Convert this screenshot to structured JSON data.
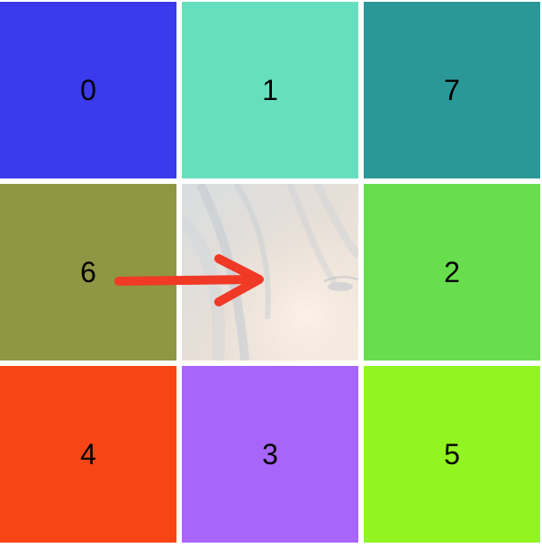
{
  "tiles": [
    {
      "label": "0",
      "color": "#3b3aed"
    },
    {
      "label": "1",
      "color": "#66dfbf"
    },
    {
      "label": "7",
      "color": "#2a9896"
    },
    {
      "label": "6",
      "color": "#909644"
    },
    {
      "label": "2",
      "color": "#68dd4d"
    },
    {
      "label": "4",
      "color": "#f84515"
    },
    {
      "label": "3",
      "color": "#a865f9"
    },
    {
      "label": "5",
      "color": "#92f522"
    }
  ],
  "empty_cell": {
    "image": "faded-face-photo",
    "row": 1,
    "column": 1
  },
  "hint_arrow": {
    "color": "#f03a26",
    "direction": "right",
    "from_tile": "6"
  }
}
